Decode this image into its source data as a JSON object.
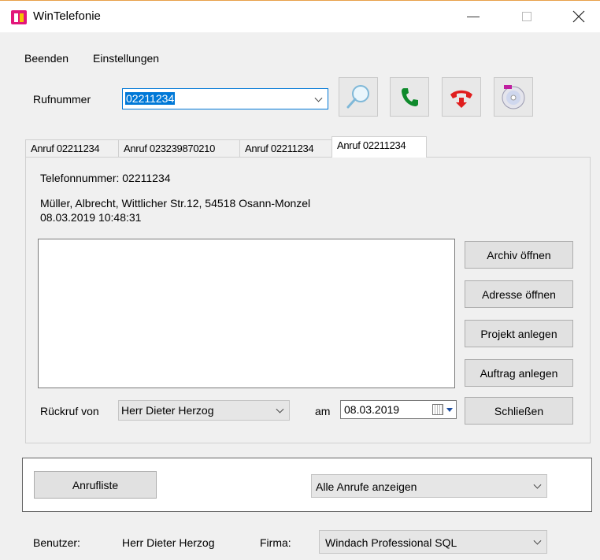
{
  "window": {
    "title": "WinTelefonie"
  },
  "menu": [
    "Beenden",
    "Einstellungen"
  ],
  "phone": {
    "label": "Rufnummer",
    "value": "02211234",
    "buttons": [
      {
        "name": "search-button",
        "icon": "magnifier-icon"
      },
      {
        "name": "call-button",
        "icon": "phone-green-icon"
      },
      {
        "name": "hangup-button",
        "icon": "phone-hangup-red-icon"
      },
      {
        "name": "cd-button",
        "icon": "cd-icon"
      }
    ]
  },
  "tabs": [
    {
      "label": "Anruf 02211234",
      "active": false
    },
    {
      "label": "Anruf 023239870210",
      "active": false
    },
    {
      "label": "Anruf 02211234",
      "active": false
    },
    {
      "label": "Anruf 02211234",
      "active": true
    }
  ],
  "call": {
    "telefonnummer": "Telefonnummer: 02211234",
    "address": "Müller, Albrecht, Wittlicher Str.12, 54518 Osann-Monzel",
    "datetime": "08.03.2019 10:48:31",
    "notes": ""
  },
  "actions": {
    "archiv": "Archiv öffnen",
    "adresse": "Adresse öffnen",
    "projekt": "Projekt anlegen",
    "auftrag": "Auftrag anlegen",
    "schliessen": "Schließen"
  },
  "callback": {
    "label": "Rückruf von",
    "person": "Herr Dieter Herzog",
    "am_label": "am",
    "date": "08.03.2019"
  },
  "calllist": {
    "button": "Anrufliste",
    "filter": "Alle Anrufe anzeigen"
  },
  "footer": {
    "benutzer_label": "Benutzer:",
    "benutzer_value": "Herr Dieter Herzog",
    "firma_label": "Firma:",
    "firma_value": "Windach Professional SQL"
  },
  "colors": {
    "accent": "#0078d7",
    "call_green": "#0f8a2c",
    "hangup_red": "#e01e1e"
  }
}
